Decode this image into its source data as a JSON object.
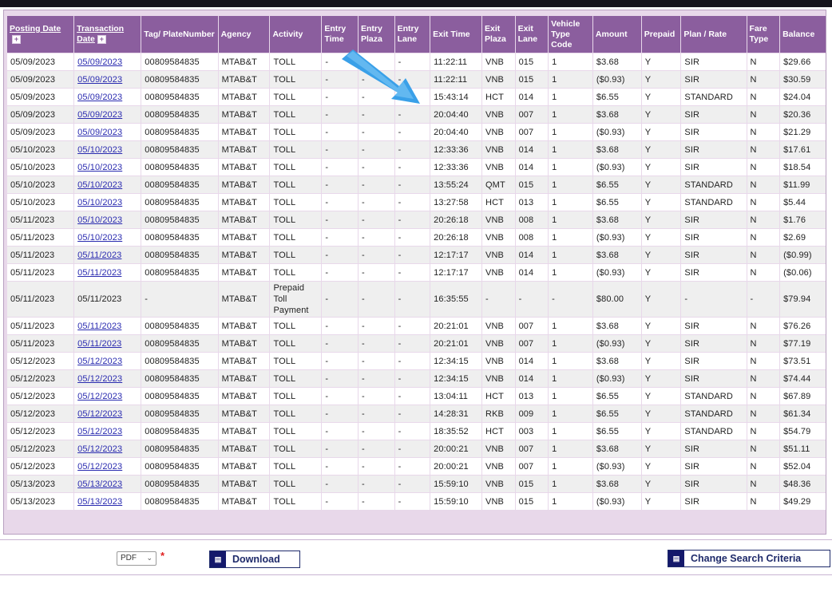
{
  "table": {
    "columns": [
      {
        "label": "Posting Date",
        "sortable": true
      },
      {
        "label": "Transaction Date",
        "sortable": true
      },
      {
        "label": "Tag/ PlateNumber",
        "sortable": false
      },
      {
        "label": "Agency",
        "sortable": false
      },
      {
        "label": "Activity",
        "sortable": false
      },
      {
        "label": "Entry Time",
        "sortable": false
      },
      {
        "label": "Entry Plaza",
        "sortable": false
      },
      {
        "label": "Entry Lane",
        "sortable": false
      },
      {
        "label": "Exit Time",
        "sortable": false
      },
      {
        "label": "Exit Plaza",
        "sortable": false
      },
      {
        "label": "Exit Lane",
        "sortable": false
      },
      {
        "label": "Vehicle Type Code",
        "sortable": false
      },
      {
        "label": "Amount",
        "sortable": false
      },
      {
        "label": "Prepaid",
        "sortable": false
      },
      {
        "label": "Plan / Rate",
        "sortable": false
      },
      {
        "label": "Fare Type",
        "sortable": false
      },
      {
        "label": "Balance",
        "sortable": false
      }
    ],
    "rows": [
      [
        "05/09/2023",
        "05/09/2023",
        "00809584835",
        "MTAB&T",
        "TOLL",
        "-",
        "-",
        "-",
        "11:22:11",
        "VNB",
        "015",
        "1",
        "$3.68",
        "Y",
        "SIR",
        "N",
        "$29.66"
      ],
      [
        "05/09/2023",
        "05/09/2023",
        "00809584835",
        "MTAB&T",
        "TOLL",
        "-",
        "-",
        "-",
        "11:22:11",
        "VNB",
        "015",
        "1",
        "($0.93)",
        "Y",
        "SIR",
        "N",
        "$30.59"
      ],
      [
        "05/09/2023",
        "05/09/2023",
        "00809584835",
        "MTAB&T",
        "TOLL",
        "-",
        "-",
        "-",
        "15:43:14",
        "HCT",
        "014",
        "1",
        "$6.55",
        "Y",
        "STANDARD",
        "N",
        "$24.04"
      ],
      [
        "05/09/2023",
        "05/09/2023",
        "00809584835",
        "MTAB&T",
        "TOLL",
        "-",
        "-",
        "-",
        "20:04:40",
        "VNB",
        "007",
        "1",
        "$3.68",
        "Y",
        "SIR",
        "N",
        "$20.36"
      ],
      [
        "05/09/2023",
        "05/09/2023",
        "00809584835",
        "MTAB&T",
        "TOLL",
        "-",
        "-",
        "-",
        "20:04:40",
        "VNB",
        "007",
        "1",
        "($0.93)",
        "Y",
        "SIR",
        "N",
        "$21.29"
      ],
      [
        "05/10/2023",
        "05/10/2023",
        "00809584835",
        "MTAB&T",
        "TOLL",
        "-",
        "-",
        "-",
        "12:33:36",
        "VNB",
        "014",
        "1",
        "$3.68",
        "Y",
        "SIR",
        "N",
        "$17.61"
      ],
      [
        "05/10/2023",
        "05/10/2023",
        "00809584835",
        "MTAB&T",
        "TOLL",
        "-",
        "-",
        "-",
        "12:33:36",
        "VNB",
        "014",
        "1",
        "($0.93)",
        "Y",
        "SIR",
        "N",
        "$18.54"
      ],
      [
        "05/10/2023",
        "05/10/2023",
        "00809584835",
        "MTAB&T",
        "TOLL",
        "-",
        "-",
        "-",
        "13:55:24",
        "QMT",
        "015",
        "1",
        "$6.55",
        "Y",
        "STANDARD",
        "N",
        "$11.99"
      ],
      [
        "05/10/2023",
        "05/10/2023",
        "00809584835",
        "MTAB&T",
        "TOLL",
        "-",
        "-",
        "-",
        "13:27:58",
        "HCT",
        "013",
        "1",
        "$6.55",
        "Y",
        "STANDARD",
        "N",
        "$5.44"
      ],
      [
        "05/11/2023",
        "05/10/2023",
        "00809584835",
        "MTAB&T",
        "TOLL",
        "-",
        "-",
        "-",
        "20:26:18",
        "VNB",
        "008",
        "1",
        "$3.68",
        "Y",
        "SIR",
        "N",
        "$1.76"
      ],
      [
        "05/11/2023",
        "05/10/2023",
        "00809584835",
        "MTAB&T",
        "TOLL",
        "-",
        "-",
        "-",
        "20:26:18",
        "VNB",
        "008",
        "1",
        "($0.93)",
        "Y",
        "SIR",
        "N",
        "$2.69"
      ],
      [
        "05/11/2023",
        "05/11/2023",
        "00809584835",
        "MTAB&T",
        "TOLL",
        "-",
        "-",
        "-",
        "12:17:17",
        "VNB",
        "014",
        "1",
        "$3.68",
        "Y",
        "SIR",
        "N",
        "($0.99)"
      ],
      [
        "05/11/2023",
        "05/11/2023",
        "00809584835",
        "MTAB&T",
        "TOLL",
        "-",
        "-",
        "-",
        "12:17:17",
        "VNB",
        "014",
        "1",
        "($0.93)",
        "Y",
        "SIR",
        "N",
        "($0.06)"
      ],
      [
        "05/11/2023",
        "05/11/2023",
        "-",
        "MTAB&T",
        "Prepaid Toll Payment",
        "-",
        "-",
        "-",
        "16:35:55",
        "-",
        "-",
        "-",
        "$80.00",
        "Y",
        "-",
        "-",
        "$79.94"
      ],
      [
        "05/11/2023",
        "05/11/2023",
        "00809584835",
        "MTAB&T",
        "TOLL",
        "-",
        "-",
        "-",
        "20:21:01",
        "VNB",
        "007",
        "1",
        "$3.68",
        "Y",
        "SIR",
        "N",
        "$76.26"
      ],
      [
        "05/11/2023",
        "05/11/2023",
        "00809584835",
        "MTAB&T",
        "TOLL",
        "-",
        "-",
        "-",
        "20:21:01",
        "VNB",
        "007",
        "1",
        "($0.93)",
        "Y",
        "SIR",
        "N",
        "$77.19"
      ],
      [
        "05/12/2023",
        "05/12/2023",
        "00809584835",
        "MTAB&T",
        "TOLL",
        "-",
        "-",
        "-",
        "12:34:15",
        "VNB",
        "014",
        "1",
        "$3.68",
        "Y",
        "SIR",
        "N",
        "$73.51"
      ],
      [
        "05/12/2023",
        "05/12/2023",
        "00809584835",
        "MTAB&T",
        "TOLL",
        "-",
        "-",
        "-",
        "12:34:15",
        "VNB",
        "014",
        "1",
        "($0.93)",
        "Y",
        "SIR",
        "N",
        "$74.44"
      ],
      [
        "05/12/2023",
        "05/12/2023",
        "00809584835",
        "MTAB&T",
        "TOLL",
        "-",
        "-",
        "-",
        "13:04:11",
        "HCT",
        "013",
        "1",
        "$6.55",
        "Y",
        "STANDARD",
        "N",
        "$67.89"
      ],
      [
        "05/12/2023",
        "05/12/2023",
        "00809584835",
        "MTAB&T",
        "TOLL",
        "-",
        "-",
        "-",
        "14:28:31",
        "RKB",
        "009",
        "1",
        "$6.55",
        "Y",
        "STANDARD",
        "N",
        "$61.34"
      ],
      [
        "05/12/2023",
        "05/12/2023",
        "00809584835",
        "MTAB&T",
        "TOLL",
        "-",
        "-",
        "-",
        "18:35:52",
        "HCT",
        "003",
        "1",
        "$6.55",
        "Y",
        "STANDARD",
        "N",
        "$54.79"
      ],
      [
        "05/12/2023",
        "05/12/2023",
        "00809584835",
        "MTAB&T",
        "TOLL",
        "-",
        "-",
        "-",
        "20:00:21",
        "VNB",
        "007",
        "1",
        "$3.68",
        "Y",
        "SIR",
        "N",
        "$51.11"
      ],
      [
        "05/12/2023",
        "05/12/2023",
        "00809584835",
        "MTAB&T",
        "TOLL",
        "-",
        "-",
        "-",
        "20:00:21",
        "VNB",
        "007",
        "1",
        "($0.93)",
        "Y",
        "SIR",
        "N",
        "$52.04"
      ],
      [
        "05/13/2023",
        "05/13/2023",
        "00809584835",
        "MTAB&T",
        "TOLL",
        "-",
        "-",
        "-",
        "15:59:10",
        "VNB",
        "015",
        "1",
        "$3.68",
        "Y",
        "SIR",
        "N",
        "$48.36"
      ],
      [
        "05/13/2023",
        "05/13/2023",
        "00809584835",
        "MTAB&T",
        "TOLL",
        "-",
        "-",
        "-",
        "15:59:10",
        "VNB",
        "015",
        "1",
        "($0.93)",
        "Y",
        "SIR",
        "N",
        "$49.29"
      ]
    ]
  },
  "footer": {
    "format_value": "PDF",
    "format_chevron": "⌄",
    "required_mark": "*",
    "download_label": "Download",
    "change_search_label": "Change Search Criteria",
    "button_icon_text": "▤"
  },
  "colors": {
    "header_bg": "#8b5e9e",
    "link": "#2a2bb0",
    "arrow": "#3aa0e8"
  },
  "icons": {
    "sort": "sort-toggle-icon",
    "annotation": "blue-arrow-annotation"
  }
}
